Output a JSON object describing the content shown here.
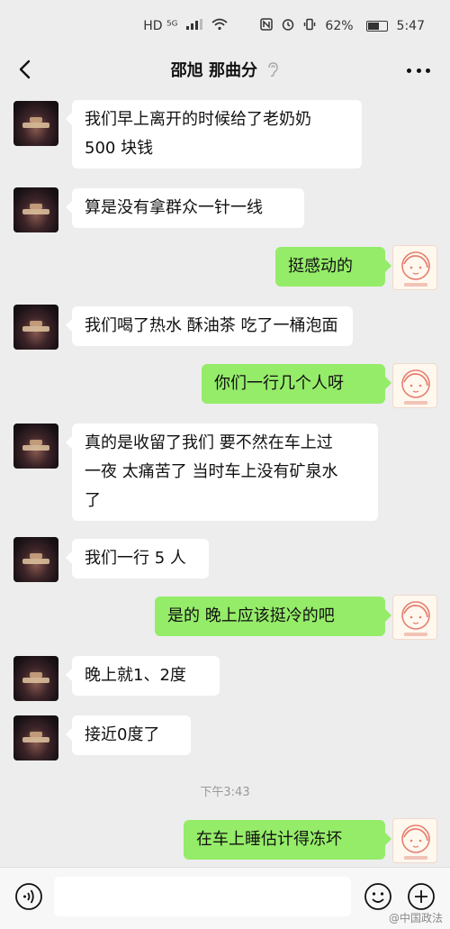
{
  "status_bar": {
    "left_text": "HD ⁵ᴳ",
    "battery": "62%",
    "time": "5:47"
  },
  "header": {
    "title": "邵旭  那曲分",
    "back_icon": "chevron-left-icon",
    "more_icon": "more-dots-icon"
  },
  "messages": [
    {
      "side": "in",
      "lines": [
        "我们早上离开的时候给了老奶奶",
        "500 块钱"
      ]
    },
    {
      "side": "in",
      "lines": [
        "算是没有拿群众一针一线"
      ]
    },
    {
      "side": "out",
      "lines": [
        "挺感动的"
      ]
    },
    {
      "side": "in",
      "lines": [
        "我们喝了热水 酥油茶 吃了一桶泡面"
      ]
    },
    {
      "side": "out",
      "lines": [
        "你们一行几个人呀"
      ]
    },
    {
      "side": "in",
      "lines": [
        "真的是收留了我们 要不然在车上过",
        "一夜 太痛苦了 当时车上没有矿泉水",
        "了"
      ]
    },
    {
      "side": "in",
      "lines": [
        "我们一行 5 人"
      ]
    },
    {
      "side": "out",
      "lines": [
        "是的  晚上应该挺冷的吧"
      ]
    },
    {
      "side": "in",
      "lines": [
        "晚上就1、2度"
      ]
    },
    {
      "side": "in",
      "lines": [
        "接近0度了"
      ]
    },
    {
      "side": "out",
      "lines": [
        "在车上睡估计得冻坏"
      ]
    }
  ],
  "timestamp": "下午3:43",
  "bottom_bar": {
    "input_value": "",
    "voice_icon": "voice-icon",
    "emoji_icon": "emoji-icon",
    "plus_icon": "plus-icon"
  },
  "watermark": "@中国政法",
  "colors": {
    "background": "#ededed",
    "incoming_bubble": "#ffffff",
    "outgoing_bubble": "#95ec69"
  }
}
